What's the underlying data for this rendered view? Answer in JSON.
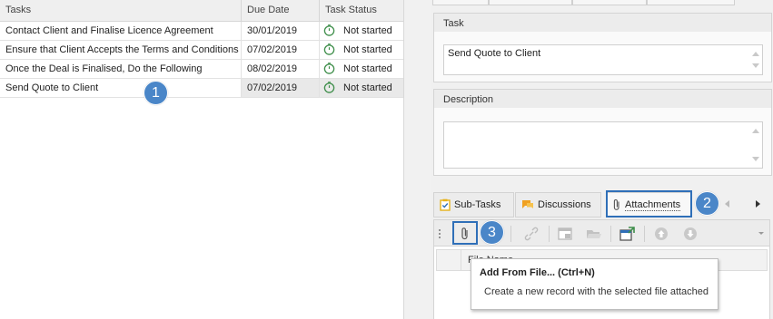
{
  "grid": {
    "columns": [
      "Tasks",
      "Due Date",
      "Task Status"
    ],
    "rows": [
      {
        "task": "Contact Client and Finalise Licence Agreement",
        "due": "30/01/2019",
        "status": "Not started"
      },
      {
        "task": "Ensure that Client Accepts the Terms and Conditions",
        "due": "07/02/2019",
        "status": "Not started"
      },
      {
        "task": "Once the Deal is Finalised, Do the Following",
        "due": "08/02/2019",
        "status": "Not started"
      },
      {
        "task": "Send Quote to Client",
        "due": "07/02/2019",
        "status": "Not started"
      }
    ],
    "selected_row": 3
  },
  "task_group": {
    "title": "Task",
    "value": "Send Quote to Client"
  },
  "description_group": {
    "title": "Description",
    "value": ""
  },
  "tabs": {
    "subtasks": "Sub-Tasks",
    "discussions": "Discussions",
    "attachments": "Attachments",
    "active": "attachments"
  },
  "attachments": {
    "column_header": "File Name"
  },
  "tooltip": {
    "title": "Add From File... (Ctrl+N)",
    "description": "Create a new record with the selected file attached"
  },
  "callouts": {
    "one": "1",
    "two": "2",
    "three": "3"
  },
  "colors": {
    "callout": "#4a86c8",
    "highlight": "#2f6fb8",
    "status_icon": "#3e8e4a",
    "discussions_icon": "#f0a020",
    "subtasks_icon": "#e7b21a"
  }
}
